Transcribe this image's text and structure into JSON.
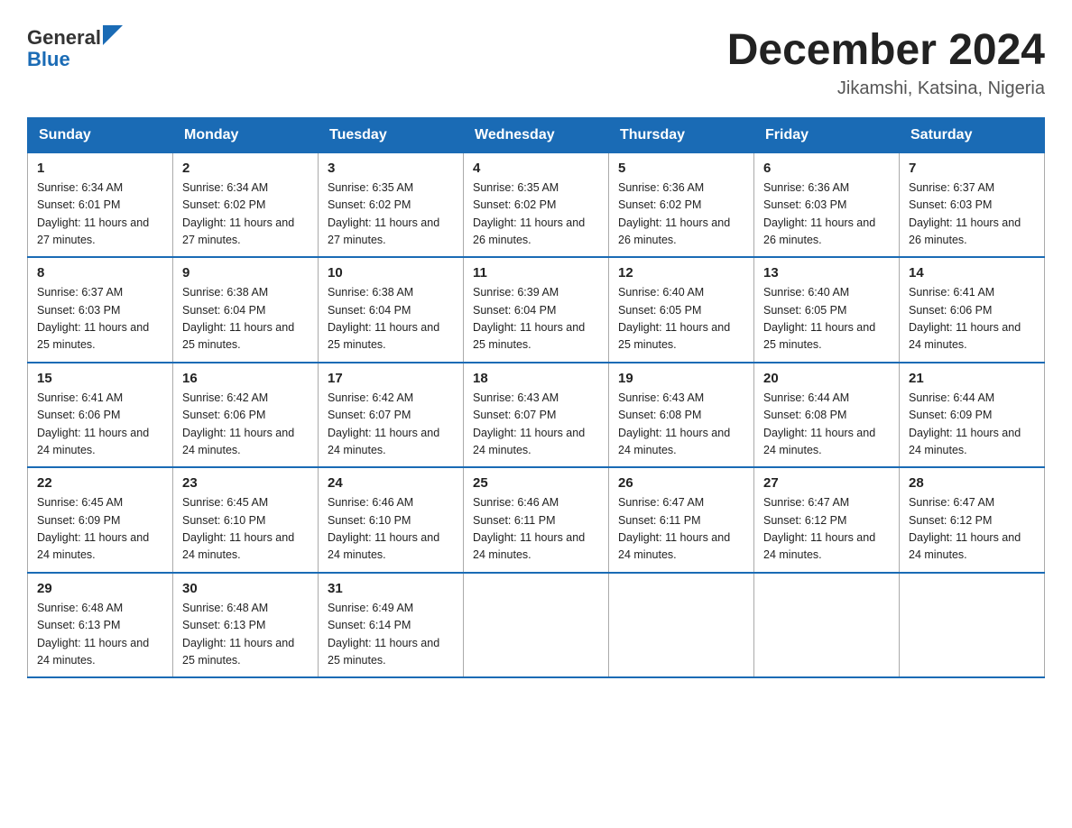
{
  "header": {
    "logo_general": "General",
    "logo_blue": "Blue",
    "month_title": "December 2024",
    "location": "Jikamshi, Katsina, Nigeria"
  },
  "days_of_week": [
    "Sunday",
    "Monday",
    "Tuesday",
    "Wednesday",
    "Thursday",
    "Friday",
    "Saturday"
  ],
  "weeks": [
    [
      {
        "day": "1",
        "sunrise": "6:34 AM",
        "sunset": "6:01 PM",
        "daylight": "11 hours and 27 minutes."
      },
      {
        "day": "2",
        "sunrise": "6:34 AM",
        "sunset": "6:02 PM",
        "daylight": "11 hours and 27 minutes."
      },
      {
        "day": "3",
        "sunrise": "6:35 AM",
        "sunset": "6:02 PM",
        "daylight": "11 hours and 27 minutes."
      },
      {
        "day": "4",
        "sunrise": "6:35 AM",
        "sunset": "6:02 PM",
        "daylight": "11 hours and 26 minutes."
      },
      {
        "day": "5",
        "sunrise": "6:36 AM",
        "sunset": "6:02 PM",
        "daylight": "11 hours and 26 minutes."
      },
      {
        "day": "6",
        "sunrise": "6:36 AM",
        "sunset": "6:03 PM",
        "daylight": "11 hours and 26 minutes."
      },
      {
        "day": "7",
        "sunrise": "6:37 AM",
        "sunset": "6:03 PM",
        "daylight": "11 hours and 26 minutes."
      }
    ],
    [
      {
        "day": "8",
        "sunrise": "6:37 AM",
        "sunset": "6:03 PM",
        "daylight": "11 hours and 25 minutes."
      },
      {
        "day": "9",
        "sunrise": "6:38 AM",
        "sunset": "6:04 PM",
        "daylight": "11 hours and 25 minutes."
      },
      {
        "day": "10",
        "sunrise": "6:38 AM",
        "sunset": "6:04 PM",
        "daylight": "11 hours and 25 minutes."
      },
      {
        "day": "11",
        "sunrise": "6:39 AM",
        "sunset": "6:04 PM",
        "daylight": "11 hours and 25 minutes."
      },
      {
        "day": "12",
        "sunrise": "6:40 AM",
        "sunset": "6:05 PM",
        "daylight": "11 hours and 25 minutes."
      },
      {
        "day": "13",
        "sunrise": "6:40 AM",
        "sunset": "6:05 PM",
        "daylight": "11 hours and 25 minutes."
      },
      {
        "day": "14",
        "sunrise": "6:41 AM",
        "sunset": "6:06 PM",
        "daylight": "11 hours and 24 minutes."
      }
    ],
    [
      {
        "day": "15",
        "sunrise": "6:41 AM",
        "sunset": "6:06 PM",
        "daylight": "11 hours and 24 minutes."
      },
      {
        "day": "16",
        "sunrise": "6:42 AM",
        "sunset": "6:06 PM",
        "daylight": "11 hours and 24 minutes."
      },
      {
        "day": "17",
        "sunrise": "6:42 AM",
        "sunset": "6:07 PM",
        "daylight": "11 hours and 24 minutes."
      },
      {
        "day": "18",
        "sunrise": "6:43 AM",
        "sunset": "6:07 PM",
        "daylight": "11 hours and 24 minutes."
      },
      {
        "day": "19",
        "sunrise": "6:43 AM",
        "sunset": "6:08 PM",
        "daylight": "11 hours and 24 minutes."
      },
      {
        "day": "20",
        "sunrise": "6:44 AM",
        "sunset": "6:08 PM",
        "daylight": "11 hours and 24 minutes."
      },
      {
        "day": "21",
        "sunrise": "6:44 AM",
        "sunset": "6:09 PM",
        "daylight": "11 hours and 24 minutes."
      }
    ],
    [
      {
        "day": "22",
        "sunrise": "6:45 AM",
        "sunset": "6:09 PM",
        "daylight": "11 hours and 24 minutes."
      },
      {
        "day": "23",
        "sunrise": "6:45 AM",
        "sunset": "6:10 PM",
        "daylight": "11 hours and 24 minutes."
      },
      {
        "day": "24",
        "sunrise": "6:46 AM",
        "sunset": "6:10 PM",
        "daylight": "11 hours and 24 minutes."
      },
      {
        "day": "25",
        "sunrise": "6:46 AM",
        "sunset": "6:11 PM",
        "daylight": "11 hours and 24 minutes."
      },
      {
        "day": "26",
        "sunrise": "6:47 AM",
        "sunset": "6:11 PM",
        "daylight": "11 hours and 24 minutes."
      },
      {
        "day": "27",
        "sunrise": "6:47 AM",
        "sunset": "6:12 PM",
        "daylight": "11 hours and 24 minutes."
      },
      {
        "day": "28",
        "sunrise": "6:47 AM",
        "sunset": "6:12 PM",
        "daylight": "11 hours and 24 minutes."
      }
    ],
    [
      {
        "day": "29",
        "sunrise": "6:48 AM",
        "sunset": "6:13 PM",
        "daylight": "11 hours and 24 minutes."
      },
      {
        "day": "30",
        "sunrise": "6:48 AM",
        "sunset": "6:13 PM",
        "daylight": "11 hours and 25 minutes."
      },
      {
        "day": "31",
        "sunrise": "6:49 AM",
        "sunset": "6:14 PM",
        "daylight": "11 hours and 25 minutes."
      },
      null,
      null,
      null,
      null
    ]
  ],
  "labels": {
    "sunrise": "Sunrise:",
    "sunset": "Sunset:",
    "daylight": "Daylight:"
  }
}
